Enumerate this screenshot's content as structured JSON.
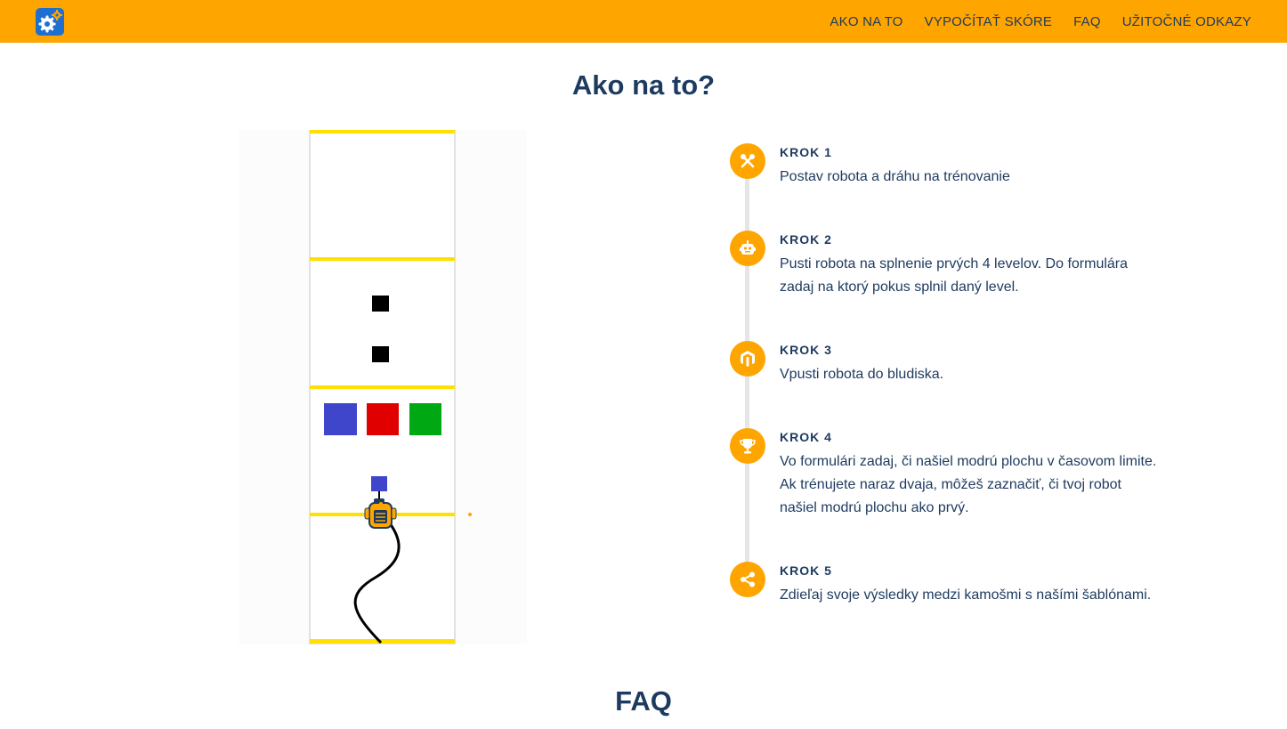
{
  "header": {
    "logo_icon": "gears-logo-icon",
    "nav": [
      {
        "label": "AKO NA TO"
      },
      {
        "label": "VYPOČÍTAŤ SKÓRE"
      },
      {
        "label": "FAQ"
      },
      {
        "label": "UŽITOČNÉ ODKAZY"
      }
    ]
  },
  "main": {
    "title": "Ako na to?",
    "steps": [
      {
        "label": "KROK 1",
        "text": "Postav robota a dráhu na trénovanie",
        "icon": "tools-icon"
      },
      {
        "label": "KROK 2",
        "text": "Pusti robota na splnenie prvých 4 levelov. Do formulára zadaj na ktorý pokus splnil daný level.",
        "icon": "robot-icon"
      },
      {
        "label": "KROK 3",
        "text": "Vpusti robota do bludiska.",
        "icon": "maze-icon"
      },
      {
        "label": "KROK 4",
        "text": "Vo formulári zadaj, či našiel modrú plochu v časovom limite. Ak trénujete naraz dvaja, môžeš zaznačiť, či tvoj robot našiel modrú plochu ako prvý.",
        "icon": "trophy-icon"
      },
      {
        "label": "KROK 5",
        "text": "Zdieľaj svoje výsledky medzi kamošmi s našími šablónami.",
        "icon": "share-icon"
      }
    ]
  },
  "faq": {
    "title": "FAQ"
  },
  "colors": {
    "accent": "#ffa500",
    "text": "#1d3a5f",
    "track_line": "#ffe000",
    "blue_square": "#4046cc",
    "red_square": "#e00000",
    "green_square": "#00a814"
  }
}
